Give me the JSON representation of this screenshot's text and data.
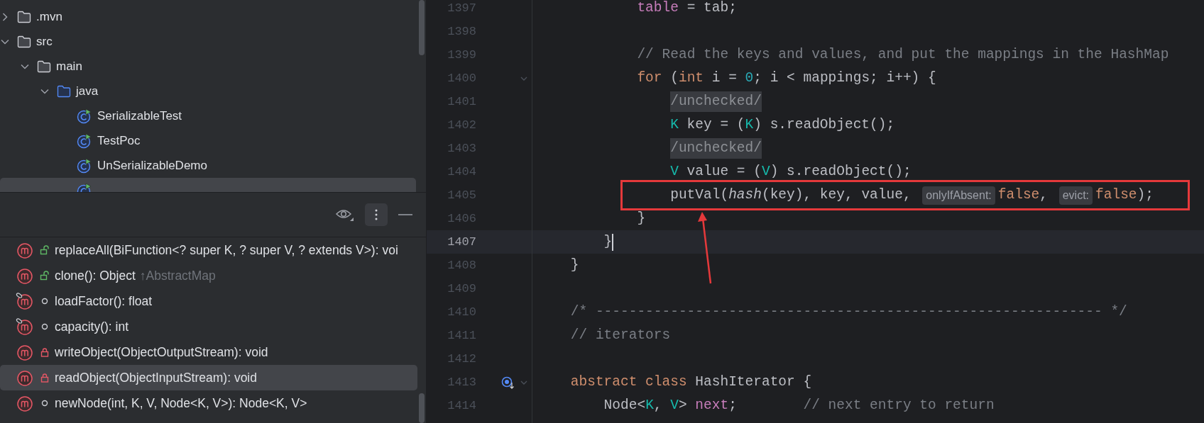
{
  "project_tree": {
    "items": [
      {
        "label": ".mvn",
        "kind": "folder",
        "expanded": false,
        "selected": false
      },
      {
        "label": "src",
        "kind": "folder",
        "expanded": true,
        "selected": false,
        "children": [
          {
            "label": "main",
            "kind": "folder",
            "expanded": true,
            "selected": false,
            "children": [
              {
                "label": "java",
                "kind": "source_folder",
                "expanded": true,
                "selected": false,
                "children": [
                  {
                    "label": "SerializableTest",
                    "kind": "class",
                    "selected": false
                  },
                  {
                    "label": "TestPoc",
                    "kind": "class",
                    "selected": false
                  },
                  {
                    "label": "UnSerializableDemo",
                    "kind": "class",
                    "selected": false
                  },
                  {
                    "kind": "class",
                    "selected": true
                  }
                ]
              }
            ]
          }
        ]
      }
    ]
  },
  "structure": {
    "members": [
      {
        "signature": "replaceAll(BiFunction<? super K, ? super V, ? extends V>): voi",
        "kind": "public",
        "overlay": false,
        "selected": false
      },
      {
        "signature": "clone(): Object",
        "inherited": "↑AbstractMap",
        "kind": "public",
        "overlay": false,
        "selected": false
      },
      {
        "signature": "loadFactor(): float",
        "kind": "package",
        "overlay": true,
        "selected": false
      },
      {
        "signature": "capacity(): int",
        "kind": "package",
        "overlay": true,
        "selected": false
      },
      {
        "signature": "writeObject(ObjectOutputStream): void",
        "kind": "private",
        "overlay": false,
        "selected": false
      },
      {
        "signature": "readObject(ObjectInputStream): void",
        "kind": "private",
        "overlay": false,
        "selected": true
      },
      {
        "signature": "newNode(int, K, V, Node<K, V>): Node<K, V>",
        "kind": "package",
        "overlay": false,
        "selected": false
      }
    ]
  },
  "editor": {
    "lines": [
      {
        "number": "1397",
        "current": false,
        "fold": false,
        "tokens": [
          {
            "kind": "field",
            "t": "            table"
          },
          {
            "kind": "plain",
            "t": " = tab;"
          }
        ]
      },
      {
        "number": "1398",
        "current": false,
        "fold": false
      },
      {
        "number": "1399",
        "current": false,
        "fold": false,
        "tokens": [
          {
            "kind": "comment",
            "t": "            // Read the keys and values, and put the mappings in the HashMap"
          }
        ]
      },
      {
        "number": "1400",
        "current": false,
        "fold": true,
        "tokens": [
          {
            "kind": "keyword",
            "t": "            for"
          },
          {
            "kind": "plain",
            "t": " ("
          },
          {
            "kind": "keyword",
            "t": "int"
          },
          {
            "kind": "plain",
            "t": " i = "
          },
          {
            "kind": "number",
            "t": "0"
          },
          {
            "kind": "plain",
            "t": "; i < mappings; i++) {"
          }
        ]
      },
      {
        "number": "1401",
        "current": false,
        "fold": false,
        "tokens": [
          {
            "kind": "folded",
            "t": "                /unchecked/"
          }
        ]
      },
      {
        "number": "1402",
        "current": false,
        "fold": false,
        "tokens": [
          {
            "kind": "type",
            "t": "                K"
          },
          {
            "kind": "plain",
            "t": " key = ("
          },
          {
            "kind": "type",
            "t": "K"
          },
          {
            "kind": "plain",
            "t": ") s.readObject();"
          }
        ]
      },
      {
        "number": "1403",
        "current": false,
        "fold": false,
        "tokens": [
          {
            "kind": "folded",
            "t": "                /unchecked/"
          }
        ]
      },
      {
        "number": "1404",
        "current": false,
        "fold": false,
        "tokens": [
          {
            "kind": "type",
            "t": "                V"
          },
          {
            "kind": "plain",
            "t": " value = ("
          },
          {
            "kind": "type",
            "t": "V"
          },
          {
            "kind": "plain",
            "t": ") s.readObject();"
          }
        ]
      },
      {
        "number": "1405",
        "current": false,
        "fold": false,
        "tokens": [
          {
            "kind": "plain",
            "t": "                putVal("
          },
          {
            "kind": "italic",
            "t": "hash"
          },
          {
            "kind": "plain",
            "t": "(key), key, value, "
          },
          {
            "kind": "hint",
            "t": "onlyIfAbsent:"
          },
          {
            "kind": "keyword",
            "t": "false"
          },
          {
            "kind": "plain",
            "t": ", "
          },
          {
            "kind": "hint",
            "t": "evict:"
          },
          {
            "kind": "keyword",
            "t": "false"
          },
          {
            "kind": "plain",
            "t": ");"
          }
        ]
      },
      {
        "number": "1406",
        "current": false,
        "fold": false,
        "tokens": [
          {
            "kind": "plain",
            "t": "            }"
          }
        ]
      },
      {
        "number": "1407",
        "current": true,
        "fold": false,
        "caret": true,
        "tokens": [
          {
            "kind": "plain",
            "t": "        }"
          }
        ]
      },
      {
        "number": "1408",
        "current": false,
        "fold": false,
        "tokens": [
          {
            "kind": "plain",
            "t": "    }"
          }
        ]
      },
      {
        "number": "1409",
        "current": false,
        "fold": false
      },
      {
        "number": "1410",
        "current": false,
        "fold": false,
        "tokens": [
          {
            "kind": "comment",
            "t": "    /* ------------------------------------------------------------- */"
          }
        ]
      },
      {
        "number": "1411",
        "current": false,
        "fold": false,
        "tokens": [
          {
            "kind": "comment",
            "t": "    // iterators"
          }
        ]
      },
      {
        "number": "1412",
        "current": false,
        "fold": false
      },
      {
        "number": "1413",
        "current": false,
        "fold": true,
        "marker": true,
        "tokens": [
          {
            "kind": "keyword",
            "t": "    abstract"
          },
          {
            "kind": "keyword",
            "t": " class"
          },
          {
            "kind": "plain",
            "t": " HashIterator {"
          }
        ]
      },
      {
        "number": "1414",
        "current": false,
        "fold": false,
        "tokens": [
          {
            "kind": "plain",
            "t": "        Node<"
          },
          {
            "kind": "type",
            "t": "K"
          },
          {
            "kind": "plain",
            "t": ", "
          },
          {
            "kind": "type",
            "t": "V"
          },
          {
            "kind": "plain",
            "t": "> "
          },
          {
            "kind": "field",
            "t": "next"
          },
          {
            "kind": "plain",
            "t": ";        "
          },
          {
            "kind": "comment",
            "t": "// next entry to return"
          }
        ]
      }
    ]
  }
}
